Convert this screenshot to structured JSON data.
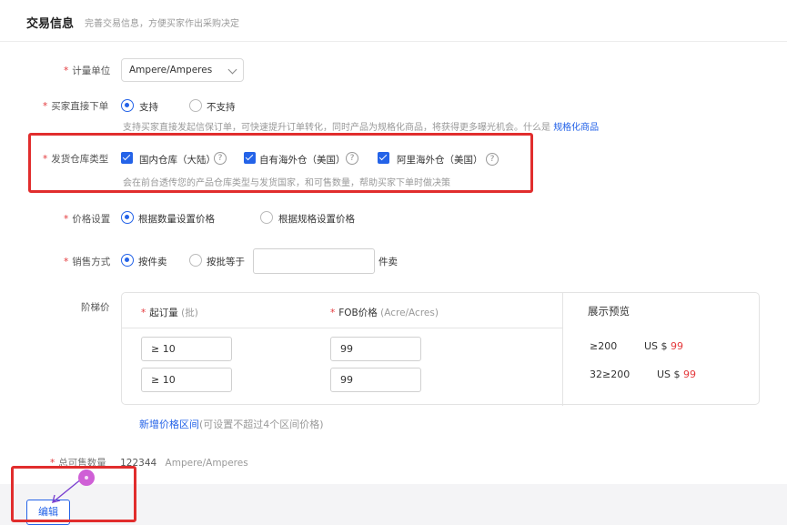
{
  "header": {
    "title": "交易信息",
    "subtitle": "完善交易信息，方便买家作出采购决定"
  },
  "required_mark": "*",
  "unit_field": {
    "label": "计量单位",
    "value": "Ampere/Amperes"
  },
  "direct_order": {
    "label": "买家直接下单",
    "options": [
      {
        "label": "支持",
        "selected": true
      },
      {
        "label": "不支持",
        "selected": false
      }
    ],
    "hint": "支持买家直接发起信保订单，可快速提升订单转化，同时产品为规格化商品，将获得更多曝光机会。什么是",
    "hint_link": "规格化商品"
  },
  "warehouse": {
    "label": "发货仓库类型",
    "options": [
      {
        "label": "国内仓库（大陆）",
        "checked": true
      },
      {
        "label": "自有海外仓（美国）",
        "checked": true
      },
      {
        "label": "阿里海外仓（美国）",
        "checked": true
      }
    ],
    "help_glyph": "?",
    "hint": "会在前台透传您的产品仓库类型与发货国家，和可售数量，帮助买家下单时做决策"
  },
  "price_setting": {
    "label": "价格设置",
    "options": [
      {
        "label": "根据数量设置价格",
        "selected": true
      },
      {
        "label": "根据规格设置价格",
        "selected": false
      }
    ]
  },
  "sale_method": {
    "label": "销售方式",
    "options": [
      {
        "label": "按件卖",
        "selected": true
      },
      {
        "label": "按批等于",
        "selected": false
      }
    ],
    "batch_value": "",
    "suffix": "件卖"
  },
  "tier_price": {
    "label": "阶梯价",
    "col_moq": "起订量",
    "col_moq_unit": "(批)",
    "col_price": "FOB价格",
    "col_price_unit": "(Acre/Acres)",
    "preview_title": "展示预览",
    "rows": [
      {
        "moq": "≥ 10",
        "price": "99"
      },
      {
        "moq": "≥ 10",
        "price": "99"
      }
    ],
    "preview": [
      {
        "range": "≥200",
        "currency": "US $",
        "price": "99"
      },
      {
        "range": "32≥200",
        "currency": "US $",
        "price": "99"
      }
    ],
    "add_link": "新增价格区间",
    "add_note": "(可设置不超过4个区间价格)"
  },
  "total": {
    "label": "总可售数量",
    "value": "122344",
    "unit": "Ampere/Amperes"
  },
  "footer": {
    "edit_button": "编辑"
  },
  "colors": {
    "accent": "#2463e8",
    "required": "#e4393c",
    "highlight_box": "#e12d2d",
    "cursor": "#cf5fd6"
  }
}
